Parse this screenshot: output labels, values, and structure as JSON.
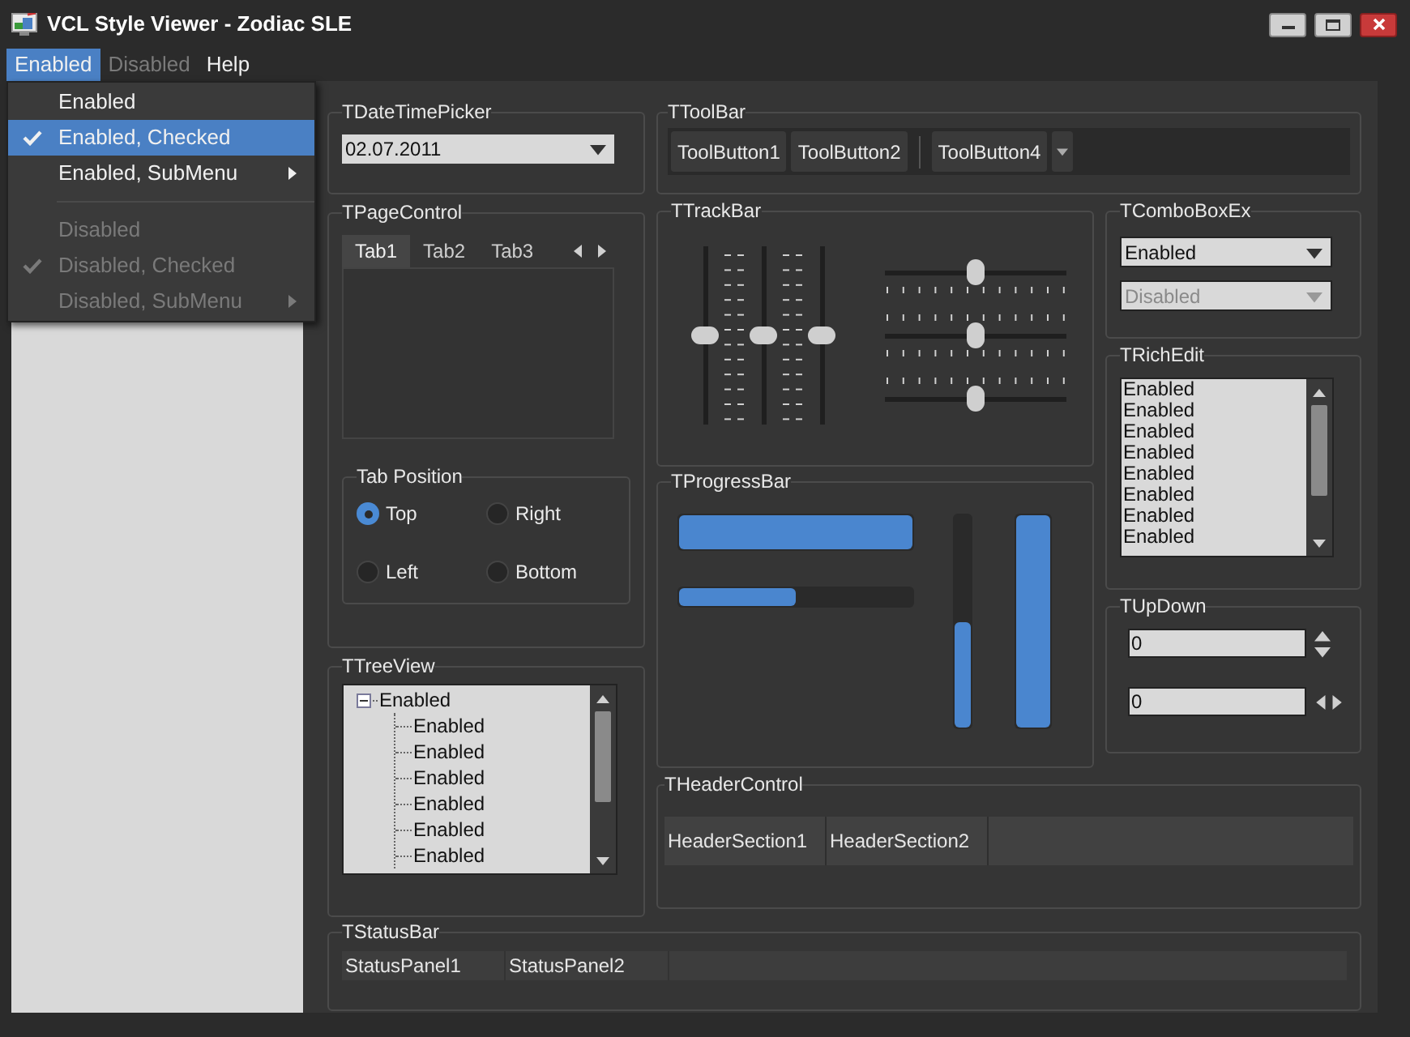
{
  "window": {
    "title": "VCL Style Viewer - Zodiac SLE"
  },
  "menu_bar": [
    {
      "label": "Enabled",
      "selected": true,
      "disabled": false
    },
    {
      "label": "Disabled",
      "selected": false,
      "disabled": true
    },
    {
      "label": "Help",
      "selected": false,
      "disabled": false
    }
  ],
  "dropdown_menu": [
    {
      "kind": "item",
      "label": "Enabled",
      "checked": false,
      "selected": false,
      "disabled": false,
      "submenu": false
    },
    {
      "kind": "item",
      "label": "Enabled, Checked",
      "checked": true,
      "selected": true,
      "disabled": false,
      "submenu": false
    },
    {
      "kind": "item",
      "label": "Enabled, SubMenu",
      "checked": false,
      "selected": false,
      "disabled": false,
      "submenu": true
    },
    {
      "kind": "separator"
    },
    {
      "kind": "item",
      "label": "Disabled",
      "checked": false,
      "selected": false,
      "disabled": true,
      "submenu": false
    },
    {
      "kind": "item",
      "label": "Disabled, Checked",
      "checked": true,
      "selected": false,
      "disabled": true,
      "submenu": false
    },
    {
      "kind": "item",
      "label": "Disabled, SubMenu",
      "checked": false,
      "selected": false,
      "disabled": true,
      "submenu": true
    }
  ],
  "date_time_picker": {
    "title": "TDateTimePicker",
    "value": "02.07.2011"
  },
  "page_control": {
    "title": "TPageControl",
    "tabs": [
      {
        "label": "Tab1",
        "selected": true
      },
      {
        "label": "Tab2",
        "selected": false
      },
      {
        "label": "Tab3",
        "selected": false
      }
    ],
    "tab_position": {
      "title": "Tab Position",
      "options": [
        {
          "label": "Top",
          "selected": true
        },
        {
          "label": "Right",
          "selected": false
        },
        {
          "label": "Left",
          "selected": false
        },
        {
          "label": "Bottom",
          "selected": false
        }
      ]
    }
  },
  "tree_view": {
    "title": "TTreeView",
    "nodes": [
      {
        "label": "Enabled",
        "expanded": true,
        "children": [
          {
            "label": "Enabled"
          },
          {
            "label": "Enabled"
          },
          {
            "label": "Enabled"
          },
          {
            "label": "Enabled"
          },
          {
            "label": "Enabled"
          },
          {
            "label": "Enabled"
          }
        ]
      }
    ]
  },
  "toolbar": {
    "title": "TToolBar",
    "items": [
      {
        "kind": "button",
        "label": "ToolButton1"
      },
      {
        "kind": "button",
        "label": "ToolButton2"
      },
      {
        "kind": "separator"
      },
      {
        "kind": "button",
        "label": "ToolButton4"
      },
      {
        "kind": "dropdown"
      }
    ]
  },
  "track_bar": {
    "title": "TTrackBar",
    "vertical_sliders": [
      {
        "level": 0.5
      },
      {
        "level": 0.5
      },
      {
        "level": 0.5
      }
    ],
    "horizontal_sliders": [
      {
        "level": 0.5
      },
      {
        "level": 0.5
      },
      {
        "level": 0.5
      }
    ]
  },
  "progress_bar": {
    "title": "TProgressBar",
    "bars": [
      {
        "kind": "horizontal",
        "level": 1
      },
      {
        "kind": "horizontal",
        "level": 0.5
      },
      {
        "kind": "vertical",
        "level": 0.5
      },
      {
        "kind": "vertical",
        "level": 1
      }
    ]
  },
  "combo_box_ex": {
    "title": "TComboBoxEx",
    "combos": [
      {
        "value": "Enabled",
        "disabled": false
      },
      {
        "value": "Disabled",
        "disabled": true
      }
    ]
  },
  "rich_edit": {
    "title": "TRichEdit",
    "lines": [
      "Enabled",
      "Enabled",
      "Enabled",
      "Enabled",
      "Enabled",
      "Enabled",
      "Enabled",
      "Enabled"
    ]
  },
  "up_down": {
    "title": "TUpDown",
    "fields": [
      {
        "kind": "vertical",
        "value": "0"
      },
      {
        "kind": "horizontal",
        "value": "0"
      }
    ]
  },
  "header_control": {
    "title": "THeaderControl",
    "sections": [
      "HeaderSection1",
      "HeaderSection2"
    ]
  },
  "status_bar": {
    "title": "TStatusBar",
    "panels": [
      "StatusPanel1",
      "StatusPanel2"
    ]
  }
}
